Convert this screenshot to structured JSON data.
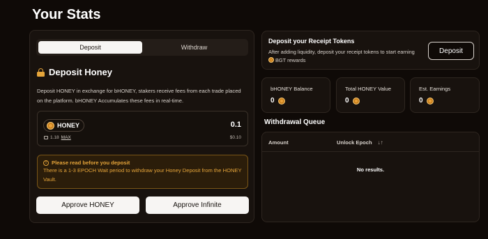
{
  "page_title": "Your Stats",
  "tabs": [
    {
      "label": "Deposit",
      "active": true
    },
    {
      "label": "Withdraw",
      "active": false
    }
  ],
  "deposit": {
    "title": "Deposit Honey",
    "description": "Deposit HONEY in exchange for bHONEY, stakers receive fees from each trade placed on the platform. bHONEY Accumulates these fees in real-time.",
    "token_symbol": "HONEY",
    "wallet_balance": "1.18",
    "max_label": "MAX",
    "amount": "0.1",
    "usd_value": "$0.10",
    "warning_title": "Please read before you deposit",
    "warning_body": "There is a 1-3 EPOCH Wait period to withdraw your Honey Deposit from the HONEY Vault.",
    "approve_label": "Approve HONEY",
    "approve_infinite_label": "Approve Infinite"
  },
  "receipt": {
    "title": "Deposit your Receipt Tokens",
    "text_line1": "After adding liquidity, deposit your receipt tokens to start earning",
    "text_line2": "BGT rewards",
    "button_label": "Deposit"
  },
  "stats": [
    {
      "label": "bHONEY Balance",
      "value": "0"
    },
    {
      "label": "Total HONEY Value",
      "value": "0"
    },
    {
      "label": "Est. Earnings",
      "value": "0"
    }
  ],
  "withdrawal_queue": {
    "title": "Withdrawal Queue",
    "columns": [
      "Amount",
      "Unlock Epoch"
    ],
    "empty_text": "No results."
  },
  "colors": {
    "background": "#0f0a07",
    "panel": "#18120e",
    "accent_honey": "#e6a53a",
    "button_light": "#f7f5f3"
  }
}
